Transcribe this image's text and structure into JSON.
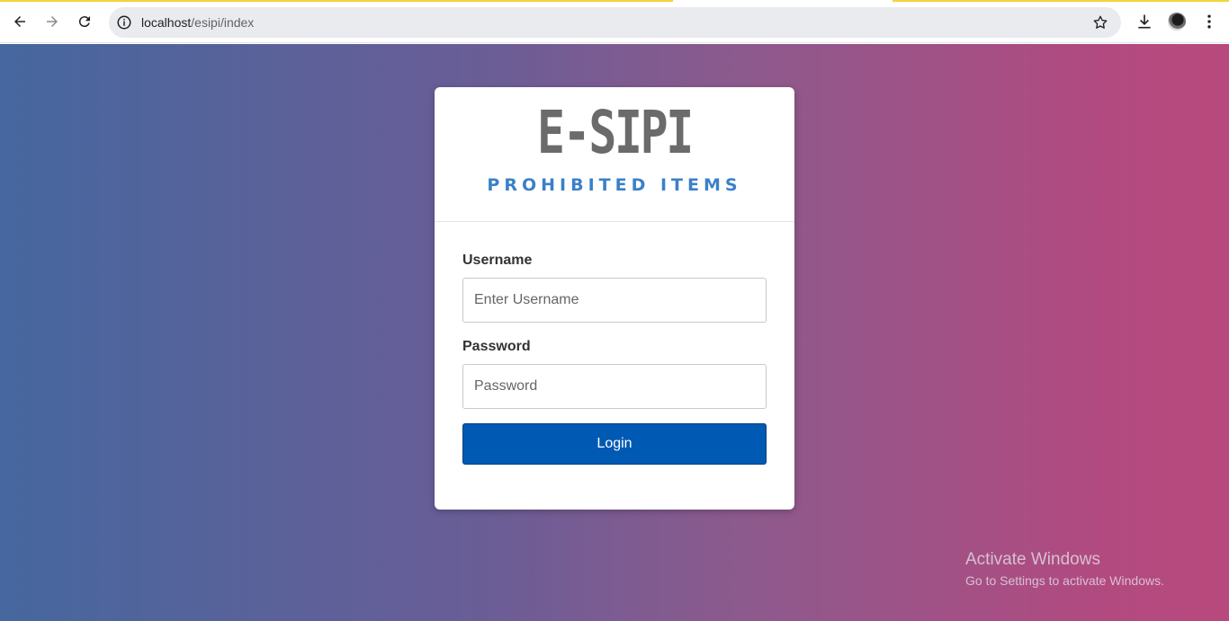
{
  "browser": {
    "url_host": "localhost",
    "url_path": "/esipi/index",
    "icons": [
      "back-icon",
      "forward-icon",
      "reload-icon",
      "site-info-icon",
      "bookmark-star-icon",
      "download-icon",
      "profile-avatar",
      "menu-kebab-icon"
    ]
  },
  "login": {
    "logo_title": "E-SIPI",
    "logo_subtitle": "PROHIBITED ITEMS",
    "username_label": "Username",
    "username_placeholder": "Enter Username",
    "password_label": "Password",
    "password_placeholder": "Password",
    "login_button": "Login"
  },
  "watermark": {
    "title": "Activate Windows",
    "subtitle": "Go to Settings to activate Windows."
  },
  "colors": {
    "gradient_left": "#46679f",
    "gradient_right": "#b8497c",
    "button": "#0059b3",
    "subtitle": "#3b80c8",
    "logo": "#6b6b6b"
  }
}
